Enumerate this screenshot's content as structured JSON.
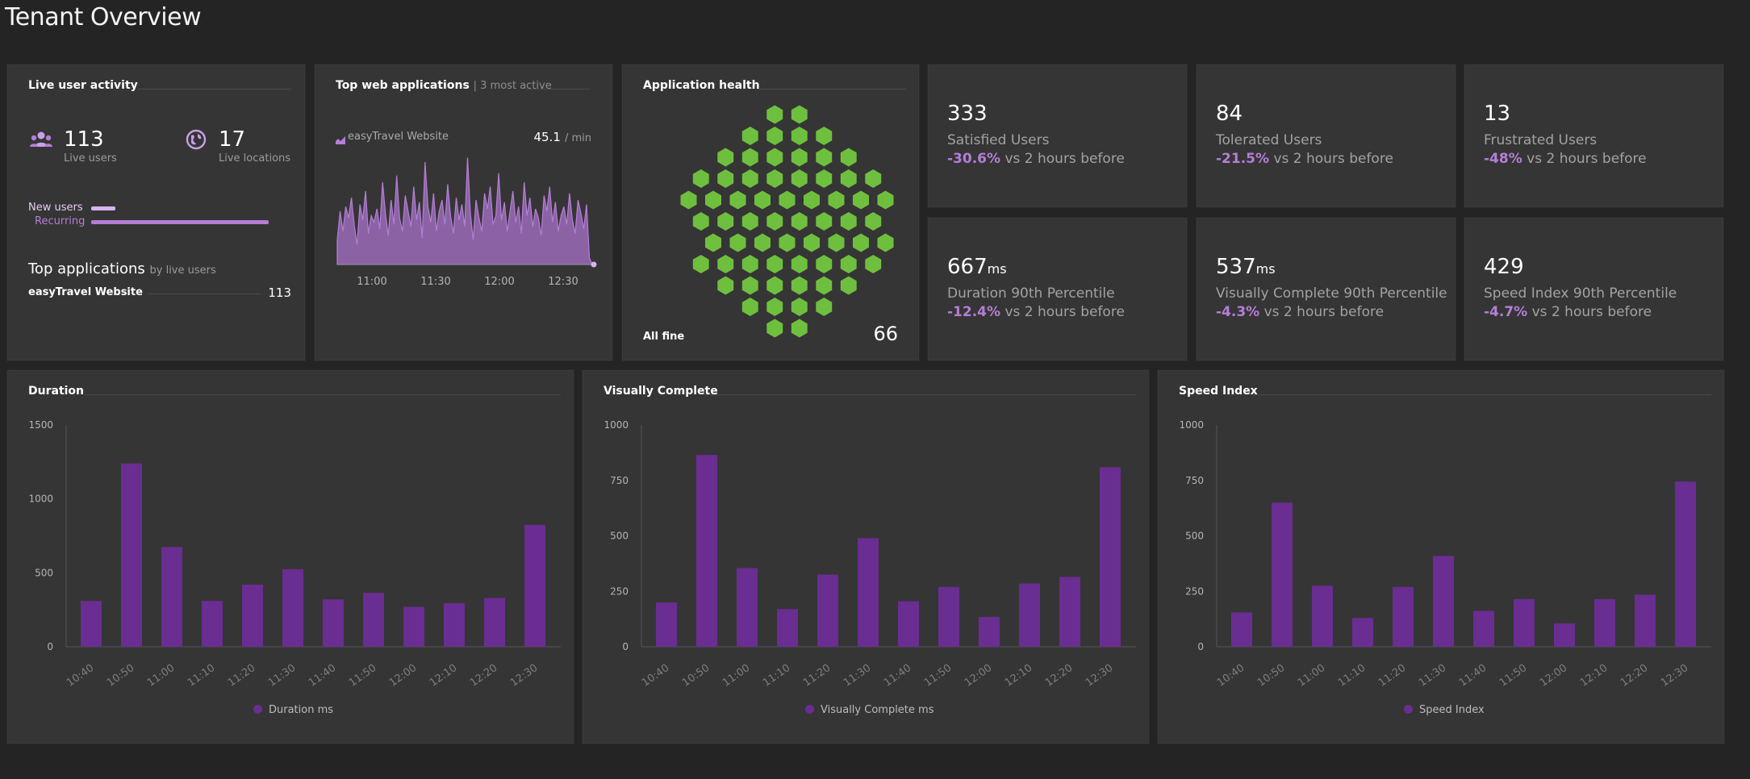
{
  "page": {
    "title": "Tenant Overview"
  },
  "live_user_activity": {
    "title": "Live user activity",
    "live_users": {
      "value": "113",
      "label": "Live users",
      "icon": "users-icon"
    },
    "live_locations": {
      "value": "17",
      "label": "Live locations",
      "icon": "globe-icon"
    },
    "new_users": {
      "label": "New users",
      "fraction": 0.12
    },
    "recurring": {
      "label": "Recurring",
      "fraction": 0.88
    },
    "top_apps": {
      "title": "Top applications",
      "subtitle": "by live users",
      "items": [
        {
          "name": "easyTravel Website",
          "value": "113"
        }
      ]
    }
  },
  "top_web_apps": {
    "title": "Top web applications",
    "subtitle": "| 3 most active",
    "app_name": "easyTravel Website",
    "app_icon": "area-chart-icon",
    "rate_value": "45.1",
    "rate_unit": "/ min",
    "sparkline": [
      22,
      48,
      30,
      52,
      42,
      60,
      35,
      18,
      54,
      40,
      66,
      28,
      44,
      38,
      50,
      32,
      74,
      46,
      26,
      58,
      36,
      80,
      42,
      30,
      62,
      48,
      34,
      70,
      40,
      56,
      24,
      92,
      52,
      38,
      64,
      30,
      48,
      58,
      36,
      72,
      44,
      28,
      60,
      40,
      54,
      34,
      96,
      46,
      22,
      58,
      42,
      30,
      64,
      50,
      70,
      36,
      44,
      82,
      40,
      56,
      30,
      48,
      66,
      38,
      52,
      28,
      74,
      44,
      60,
      34,
      50,
      42,
      26,
      62,
      48,
      70,
      38,
      56,
      30,
      44,
      52,
      36,
      64,
      40,
      28,
      58,
      46,
      32,
      54,
      6,
      0
    ],
    "x_labels": [
      "11:00",
      "11:30",
      "12:00",
      "12:30"
    ],
    "line_color": "#b57ed6"
  },
  "app_health": {
    "title": "Application health",
    "status": "All fine",
    "count": "66",
    "hex_color": "#6fbf3f"
  },
  "kpis": [
    {
      "value": "333",
      "unit": "",
      "label": "Satisfied Users",
      "delta": "-30.6%",
      "delta_text": "vs 2 hours before"
    },
    {
      "value": "84",
      "unit": "",
      "label": "Tolerated Users",
      "delta": "-21.5%",
      "delta_text": "vs 2 hours before"
    },
    {
      "value": "13",
      "unit": "",
      "label": "Frustrated Users",
      "delta": "-48%",
      "delta_text": "vs 2 hours before"
    },
    {
      "value": "667",
      "unit": "ms",
      "label": "Duration 90th Percentile",
      "delta": "-12.4%",
      "delta_text": "vs 2 hours before"
    },
    {
      "value": "537",
      "unit": "ms",
      "label": "Visually Complete 90th Percentile",
      "delta": "-4.3%",
      "delta_text": "vs 2 hours before"
    },
    {
      "value": "429",
      "unit": "",
      "label": "Speed Index 90th Percentile",
      "delta": "-4.7%",
      "delta_text": "vs 2 hours before"
    }
  ],
  "colors": {
    "accent": "#b57ed6",
    "bar": "#6a2d91",
    "health": "#6fbf3f"
  },
  "chart_data": [
    {
      "type": "bar",
      "title": "Duration",
      "categories": [
        "10:40",
        "10:50",
        "11:00",
        "11:10",
        "11:20",
        "11:30",
        "11:40",
        "11:50",
        "12:00",
        "12:10",
        "12:20",
        "12:30"
      ],
      "series": [
        {
          "name": "Duration ms",
          "values": [
            310,
            1240,
            675,
            310,
            420,
            525,
            320,
            365,
            270,
            295,
            330,
            825
          ]
        }
      ],
      "ylim": [
        0,
        1500
      ],
      "yticks": [
        0,
        500,
        1000,
        1500
      ],
      "grid": false,
      "legend": "bottom"
    },
    {
      "type": "bar",
      "title": "Visually Complete",
      "categories": [
        "10:40",
        "10:50",
        "11:00",
        "11:10",
        "11:20",
        "11:30",
        "11:40",
        "11:50",
        "12:00",
        "12:10",
        "12:20",
        "12:30"
      ],
      "series": [
        {
          "name": "Visually Complete ms",
          "values": [
            200,
            865,
            355,
            170,
            325,
            490,
            205,
            270,
            135,
            285,
            315,
            810
          ]
        }
      ],
      "ylim": [
        0,
        1000
      ],
      "yticks": [
        0,
        250,
        500,
        750,
        1000
      ],
      "grid": false,
      "legend": "bottom"
    },
    {
      "type": "bar",
      "title": "Speed Index",
      "categories": [
        "10:40",
        "10:50",
        "11:00",
        "11:10",
        "11:20",
        "11:30",
        "11:40",
        "11:50",
        "12:00",
        "12:10",
        "12:20",
        "12:30"
      ],
      "series": [
        {
          "name": "Speed Index",
          "values": [
            155,
            650,
            275,
            130,
            270,
            410,
            162,
            215,
            105,
            215,
            235,
            745
          ]
        }
      ],
      "ylim": [
        0,
        1000
      ],
      "yticks": [
        0,
        250,
        500,
        750,
        1000
      ],
      "grid": false,
      "legend": "bottom"
    }
  ]
}
